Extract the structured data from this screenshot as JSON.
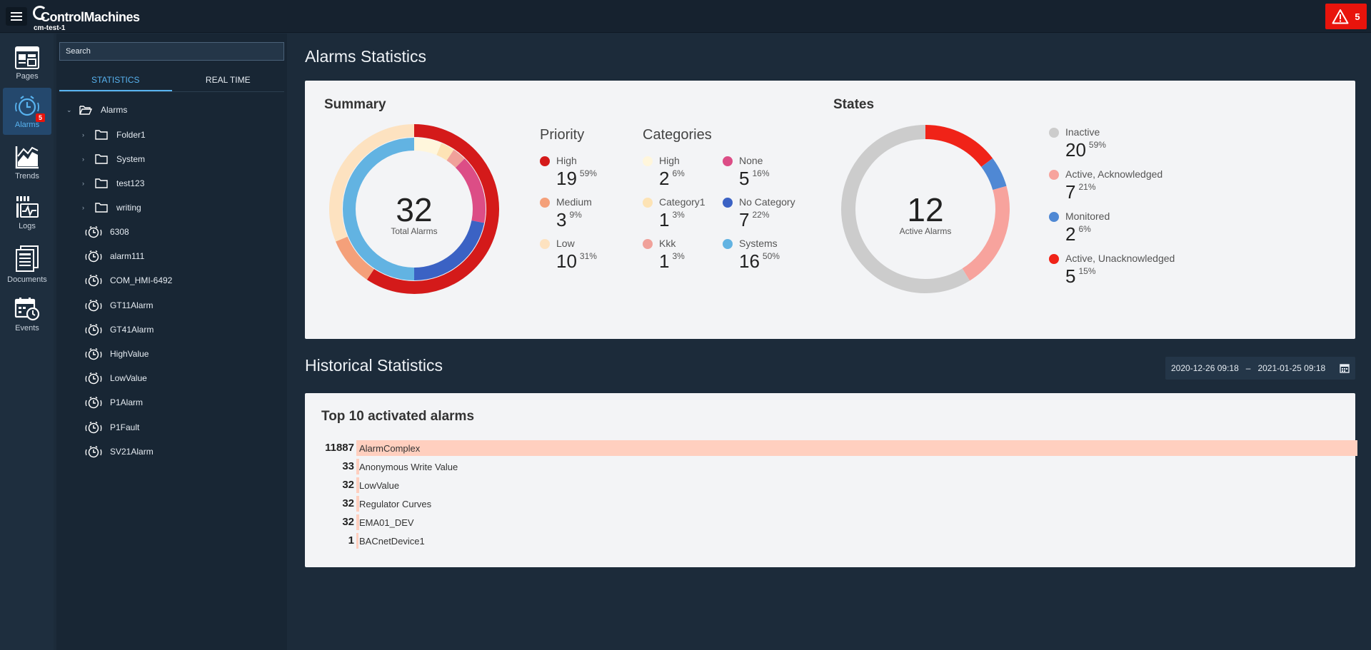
{
  "header": {
    "brand": "ControlMachines",
    "instance": "cm-test-1",
    "alarm_count": "5"
  },
  "rail": {
    "items": [
      {
        "label": "Pages",
        "icon": "pages-icon"
      },
      {
        "label": "Alarms",
        "icon": "alarm-clock-icon",
        "badge": "5"
      },
      {
        "label": "Trends",
        "icon": "trends-icon"
      },
      {
        "label": "Logs",
        "icon": "logs-icon"
      },
      {
        "label": "Documents",
        "icon": "documents-icon"
      },
      {
        "label": "Events",
        "icon": "events-calendar-icon"
      }
    ]
  },
  "tree": {
    "search_placeholder": "Search",
    "tabs": [
      "STATISTICS",
      "REAL TIME"
    ],
    "root": "Alarms",
    "folders": [
      "Folder1",
      "System",
      "test123",
      "writing"
    ],
    "alarms": [
      "6308",
      "alarm111",
      "COM_HMI-6492",
      "GT11Alarm",
      "GT41Alarm",
      "HighValue",
      "LowValue",
      "P1Alarm",
      "P1Fault",
      "SV21Alarm"
    ]
  },
  "main": {
    "title": "Alarms Statistics",
    "summary": {
      "title": "Summary",
      "total": "32",
      "total_label": "Total Alarms",
      "priority_title": "Priority",
      "priority": [
        {
          "label": "High",
          "value": "19",
          "pct": "59%",
          "color": "#d41a1a"
        },
        {
          "label": "Medium",
          "value": "3",
          "pct": "9%",
          "color": "#f4a07a"
        },
        {
          "label": "Low",
          "value": "10",
          "pct": "31%",
          "color": "#fde2c0"
        }
      ],
      "categories_title": "Categories",
      "categories": [
        {
          "label": "High",
          "value": "2",
          "pct": "6%",
          "color": "#fff6dc"
        },
        {
          "label": "Category1",
          "value": "1",
          "pct": "3%",
          "color": "#fde3b5"
        },
        {
          "label": "Kkk",
          "value": "1",
          "pct": "3%",
          "color": "#f0a19a"
        },
        {
          "label": "None",
          "value": "5",
          "pct": "16%",
          "color": "#dc4d86"
        },
        {
          "label": "No Category",
          "value": "7",
          "pct": "22%",
          "color": "#3b62c4"
        },
        {
          "label": "Systems",
          "value": "16",
          "pct": "50%",
          "color": "#62b3e2"
        }
      ]
    },
    "states": {
      "title": "States",
      "active": "12",
      "active_label": "Active Alarms",
      "items": [
        {
          "label": "Inactive",
          "value": "20",
          "pct": "59%",
          "color": "#cccccc"
        },
        {
          "label": "Active, Acknowledged",
          "value": "7",
          "pct": "21%",
          "color": "#f7a39d"
        },
        {
          "label": "Monitored",
          "value": "2",
          "pct": "6%",
          "color": "#4f88d4"
        },
        {
          "label": "Active, Unacknowledged",
          "value": "5",
          "pct": "15%",
          "color": "#f02318"
        }
      ]
    },
    "historical": {
      "title": "Historical Statistics",
      "date_from": "2020-12-26 09:18",
      "date_sep": "–",
      "date_to": "2021-01-25 09:18",
      "top_title": "Top 10 activated alarms",
      "bar_color": "#ffcfbf",
      "top": [
        {
          "count": "11887",
          "value": 11887,
          "name": "AlarmComplex"
        },
        {
          "count": "33",
          "value": 33,
          "name": "Anonymous Write Value"
        },
        {
          "count": "32",
          "value": 32,
          "name": "LowValue"
        },
        {
          "count": "32",
          "value": 32,
          "name": "Regulator Curves"
        },
        {
          "count": "32",
          "value": 32,
          "name": "EMA01_DEV"
        },
        {
          "count": "1",
          "value": 1,
          "name": "BACnetDevice1"
        }
      ]
    }
  }
}
